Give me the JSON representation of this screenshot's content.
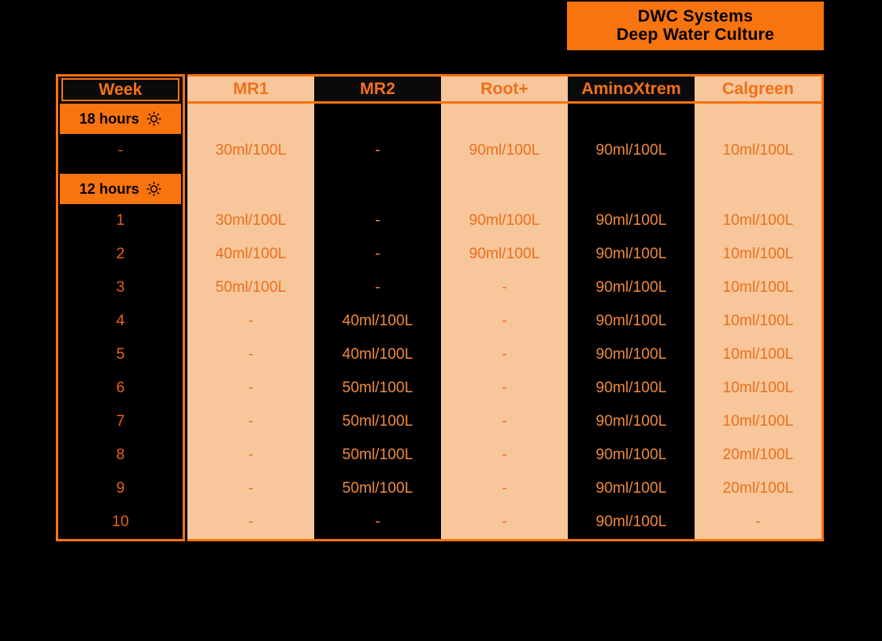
{
  "title": {
    "line1": "DWC Systems",
    "line2": "Deep Water Culture"
  },
  "colors": {
    "background": "#000000",
    "accent_orange": "#F8740F",
    "column_peach": "#F8C69B",
    "value_text_on_peach": "#E8701B",
    "value_text_on_black": "#F08A3E",
    "header_text": "#F0701A",
    "title_text": "#000000"
  },
  "table": {
    "week_header": "Week",
    "columns": [
      {
        "label": "MR1",
        "shade": "peach",
        "icon": "none"
      },
      {
        "label": "MR2",
        "shade": "dark",
        "icon": "none"
      },
      {
        "label": "Root+",
        "shade": "peach",
        "icon": "none"
      },
      {
        "label": "AminoXtrem",
        "shade": "dark",
        "icon": "none"
      },
      {
        "label": "Calgreen",
        "shade": "peach",
        "icon": "none"
      }
    ],
    "groups": [
      {
        "band_label": "18 hours",
        "band_icon": "sun-icon",
        "rows": [
          {
            "week": "-",
            "values": [
              "30ml/100L",
              "-",
              "90ml/100L",
              "90ml/100L",
              "10ml/100L"
            ]
          }
        ]
      },
      {
        "band_label": "12 hours",
        "band_icon": "sun-icon",
        "rows": [
          {
            "week": "1",
            "values": [
              "30ml/100L",
              "-",
              "90ml/100L",
              "90ml/100L",
              "10ml/100L"
            ]
          },
          {
            "week": "2",
            "values": [
              "40ml/100L",
              "-",
              "90ml/100L",
              "90ml/100L",
              "10ml/100L"
            ]
          },
          {
            "week": "3",
            "values": [
              "50ml/100L",
              "-",
              "-",
              "90ml/100L",
              "10ml/100L"
            ]
          },
          {
            "week": "4",
            "values": [
              "-",
              "40ml/100L",
              "-",
              "90ml/100L",
              "10ml/100L"
            ]
          },
          {
            "week": "5",
            "values": [
              "-",
              "40ml/100L",
              "-",
              "90ml/100L",
              "10ml/100L"
            ]
          },
          {
            "week": "6",
            "values": [
              "-",
              "50ml/100L",
              "-",
              "90ml/100L",
              "10ml/100L"
            ]
          },
          {
            "week": "7",
            "values": [
              "-",
              "50ml/100L",
              "-",
              "90ml/100L",
              "10ml/100L"
            ]
          },
          {
            "week": "8",
            "values": [
              "-",
              "50ml/100L",
              "-",
              "90ml/100L",
              "20ml/100L"
            ]
          },
          {
            "week": "9",
            "values": [
              "-",
              "50ml/100L",
              "-",
              "90ml/100L",
              "20ml/100L"
            ]
          },
          {
            "week": "10",
            "values": [
              "-",
              "-",
              "-",
              "90ml/100L",
              "-"
            ]
          }
        ]
      }
    ]
  }
}
